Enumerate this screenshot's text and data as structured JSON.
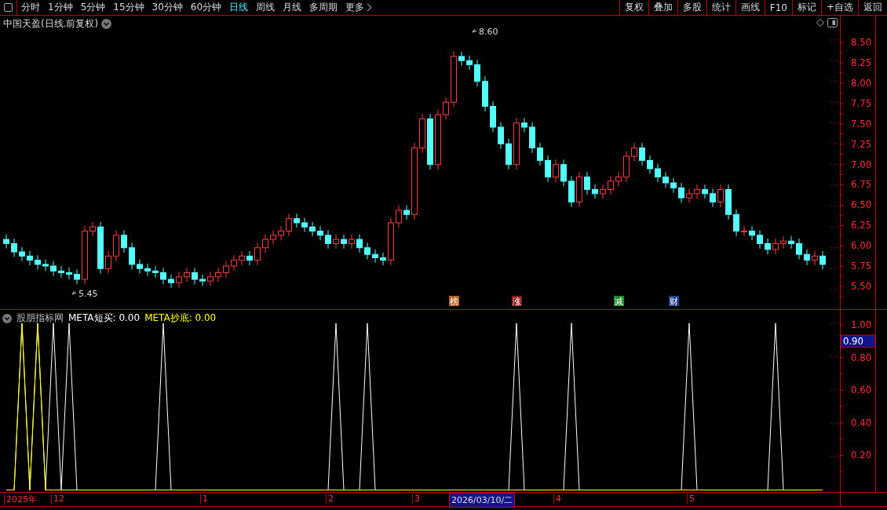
{
  "toolbar": {
    "periods": [
      {
        "label": "分时",
        "selected": false
      },
      {
        "label": "1分钟",
        "selected": false
      },
      {
        "label": "5分钟",
        "selected": false
      },
      {
        "label": "15分钟",
        "selected": false
      },
      {
        "label": "30分钟",
        "selected": false
      },
      {
        "label": "60分钟",
        "selected": false
      },
      {
        "label": "日线",
        "selected": true
      },
      {
        "label": "周线",
        "selected": false
      },
      {
        "label": "月线",
        "selected": false
      },
      {
        "label": "多周期",
        "selected": false
      }
    ],
    "more": "更多",
    "tools": [
      "复权",
      "叠加",
      "多股",
      "统计",
      "画线",
      "F10",
      "标记",
      "+自选",
      "返回"
    ]
  },
  "price_chart": {
    "title": "中国天盈(日线.前复权)",
    "high_label": "8.60",
    "low_label": "5.45",
    "price_axis": [
      "8.50",
      "8.25",
      "8.00",
      "7.75",
      "7.50",
      "7.25",
      "7.00",
      "6.75",
      "6.50",
      "6.25",
      "6.00",
      "5.75",
      "5.50"
    ],
    "markers": [
      {
        "label": "榜",
        "color": "#b8621e"
      },
      {
        "label": "涨",
        "color": "#8c1c1c"
      },
      {
        "label": "减",
        "color": "#1f8a2e"
      },
      {
        "label": "财",
        "color": "#24408c"
      }
    ]
  },
  "indicator": {
    "name": "股朋指标网",
    "readouts": [
      {
        "label": "META短买: 0.00",
        "color": "#ffffff"
      },
      {
        "label": "META抄底: 0.00",
        "color": "#ffff00"
      }
    ],
    "value_axis": [
      "1.00",
      "0.80",
      "0.60",
      "0.40",
      "0.20"
    ],
    "cursor_value": "0.90"
  },
  "time_axis": {
    "labels": [
      "2025年",
      "12",
      "1",
      "2",
      "3",
      "4",
      "5"
    ],
    "cursor_date": "2026/03/10/二"
  }
}
